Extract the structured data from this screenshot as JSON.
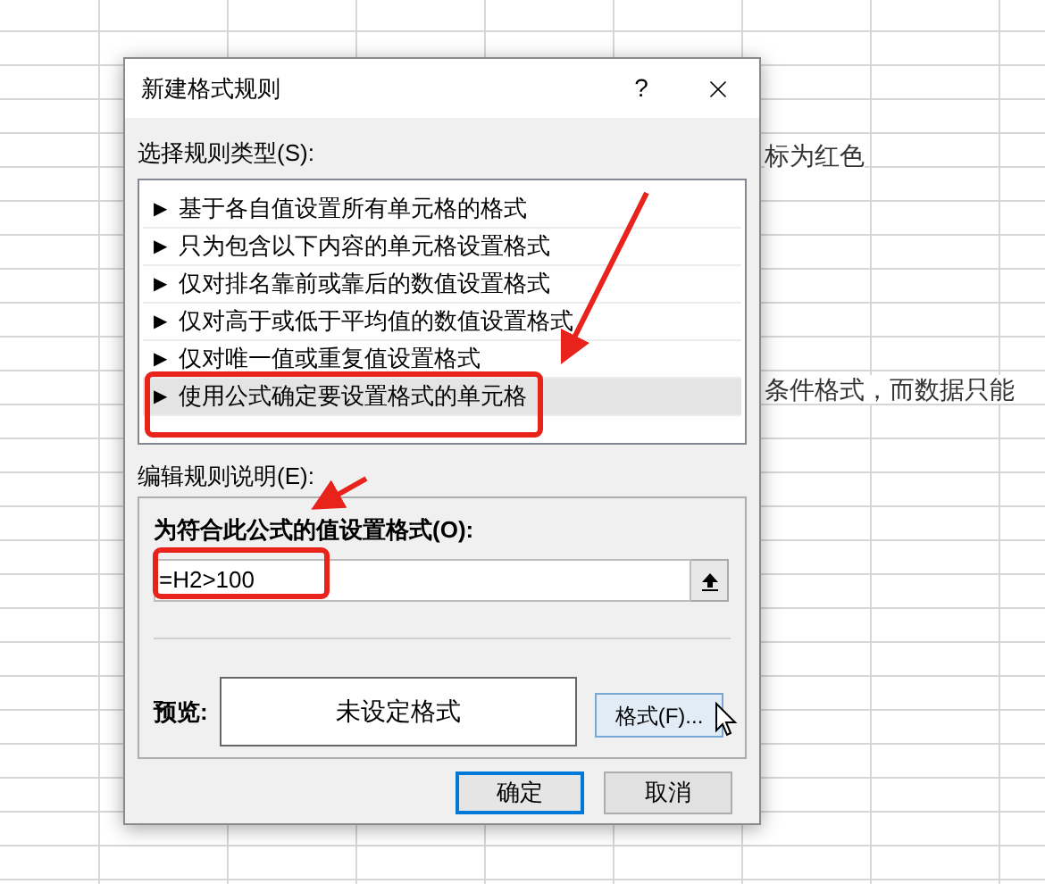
{
  "sheet_cells": [
    {
      "text": "标为红色"
    },
    {
      "text": "条件格式，而数据只能"
    }
  ],
  "window": {
    "title": "新建格式规则",
    "help": "?"
  },
  "rule_type_label": "选择规则类型(S):",
  "rule_types": [
    {
      "arrow": "▶",
      "label": "基于各自值设置所有单元格的格式",
      "selected": false
    },
    {
      "arrow": "▶",
      "label": "只为包含以下内容的单元格设置格式",
      "selected": false
    },
    {
      "arrow": "▶",
      "label": "仅对排名靠前或靠后的数值设置格式",
      "selected": false
    },
    {
      "arrow": "▶",
      "label": "仅对高于或低于平均值的数值设置格式",
      "selected": false
    },
    {
      "arrow": "▶",
      "label": "仅对唯一值或重复值设置格式",
      "selected": false
    },
    {
      "arrow": "▶",
      "label": "使用公式确定要设置格式的单元格",
      "selected": true
    }
  ],
  "edit_label": "编辑规则说明(E):",
  "formula_label": "为符合此公式的值设置格式(O):",
  "formula": {
    "value": "=H2>100"
  },
  "preview_label": "预览:",
  "preview_text": "未设定格式",
  "format_button": "格式(F)...",
  "buttons": [
    {
      "label": "确定",
      "default": true
    },
    {
      "label": "取消",
      "default": false
    }
  ]
}
